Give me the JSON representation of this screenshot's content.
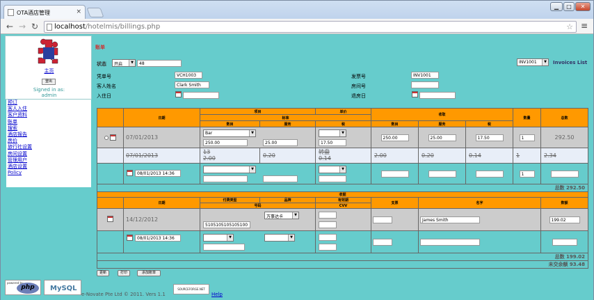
{
  "browser": {
    "tab_title": "OTA酒店管理",
    "tab_close": "×",
    "url_host": "localhost",
    "url_path": "/hotelmis/billings.php",
    "win_min": "▁",
    "win_max": "□",
    "win_close": "✕"
  },
  "sidebar": {
    "home": "主页",
    "logout_label": "登出",
    "signed_in": "Signed in as:",
    "user": "admin",
    "menu": [
      "预订",
      "客人入住",
      "客户资料",
      "账单",
      "搜索",
      "酒店报告",
      "房价",
      "旅行社设置",
      "房间设置",
      "管理用户",
      "酒店设置",
      "Policy"
    ]
  },
  "page": {
    "title": "账单",
    "status_label": "状态",
    "status_value": "开启",
    "status_num": "48",
    "invoice_select": "INV1001",
    "invoices_list": "Invoices List",
    "voucher_label": "凭单号",
    "voucher_value": "VCH1003",
    "guest_label": "客人姓名",
    "guest_value": "Clark Smith",
    "checkin_label": "入住日",
    "invoice_label": "发票号",
    "invoice_value": "INV1001",
    "room_label": "房间号",
    "checkout_label": "退房日"
  },
  "charges": {
    "h_date": "日期",
    "h_item": "项目",
    "h_price": "单价",
    "h_standard": "标准",
    "h_qty": "数目",
    "h_service": "服务",
    "h_tax": "税",
    "h_collect": "收取",
    "h_qty2": "数目",
    "h_service2": "服务",
    "h_tax2": "税",
    "h_count": "数量",
    "h_total": "总数",
    "row1": {
      "date": "07/01/2013",
      "item": "Bar",
      "qty": "250.00",
      "service": "25.00",
      "tax": "17.50",
      "cqty": "250.00",
      "cservice": "25.00",
      "ctax": "17.50",
      "count": "1",
      "total": "292.50"
    },
    "row2": {
      "date": "07/01/2013",
      "item": "13",
      "qty": "2.00",
      "service": "0.20",
      "tax_label": "转盘",
      "tax": "0.14",
      "cqty": "2.00",
      "cservice": "0.20",
      "ctax": "0.14",
      "count": "1",
      "total": "2.34"
    },
    "row3": {
      "date": "08/01/2013 14:36",
      "count": "1"
    },
    "sum_label": "总数",
    "sum_value": "292.50"
  },
  "payments": {
    "h_receipt": "收据",
    "h_date": "日期",
    "h_paytype": "付费类型",
    "h_bank": "品牌",
    "h_expiry": "有效期",
    "h_cardno": "号码",
    "h_cvv": "CVV",
    "h_cheque": "支票",
    "h_name": "名字",
    "h_amount": "数额",
    "row1": {
      "date": "14/12/2012",
      "bank": "万事达卡",
      "cardno": "5105105105105100",
      "name": "James Smith",
      "amount": "199.02"
    },
    "row2": {
      "date": "08/01/2013 14:36"
    },
    "sum_label": "总数",
    "sum_value": "199.02",
    "balance_label": "未交余额",
    "balance_value": "93.48"
  },
  "buttons": {
    "update": "更新",
    "print": "打印",
    "add": "添加账单"
  },
  "footer": {
    "powered": "powered by",
    "php": "php",
    "mysql": "MySQL",
    "copyright": "e-Novate Pte Ltd © 2011. Vers 1.1",
    "sf": "SOURCEFORGE.NET",
    "help": "Help"
  },
  "colors": {
    "bg": "#66cccc",
    "header": "#ff9900",
    "row": "#cccccc",
    "title": "#cc3333"
  }
}
